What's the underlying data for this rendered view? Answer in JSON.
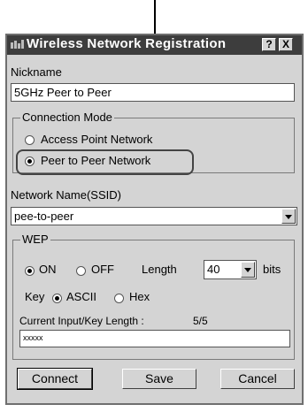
{
  "window": {
    "title": "Wireless Network Registration",
    "help_label": "?",
    "close_label": "X"
  },
  "nickname": {
    "label": "Nickname",
    "value": "5GHz Peer to Peer"
  },
  "connection_mode": {
    "legend": "Connection Mode",
    "options": [
      {
        "label": "Access Point Network",
        "selected": false
      },
      {
        "label": "Peer to Peer Network",
        "selected": true
      }
    ]
  },
  "network_name": {
    "label": "Network Name(SSID)",
    "value": "pee-to-peer"
  },
  "wep": {
    "legend": "WEP",
    "on_label": "ON",
    "off_label": "OFF",
    "on_selected": true,
    "length_label": "Length",
    "length_value": "40",
    "bits_label": "bits",
    "key_label": "Key",
    "ascii_label": "ASCII",
    "hex_label": "Hex",
    "ascii_selected": true,
    "current_length_label": "Current Input/Key Length :",
    "current_length_value": "5/5",
    "key_input_value": "xxxxx"
  },
  "buttons": {
    "connect": "Connect",
    "save": "Save",
    "cancel": "Cancel"
  }
}
